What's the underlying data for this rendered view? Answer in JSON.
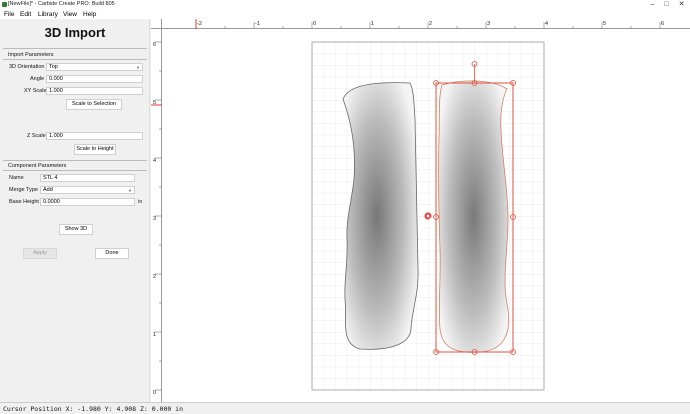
{
  "window": {
    "title": "[NewFile]* - Carbide Create PRO: Build 805",
    "minimize_glyph": "–",
    "maximize_glyph": "□",
    "close_glyph": "✕"
  },
  "menu": [
    "File",
    "Edit",
    "Library",
    "View",
    "Help"
  ],
  "panel": {
    "title": "3D Import",
    "import_section": "Import Parameters",
    "orientation_label": "3D Orientation",
    "orientation_value": "Top",
    "angle_label": "Angle",
    "angle_value": "0.000",
    "xy_scale_label": "XY Scale",
    "xy_scale_value": "1.000",
    "scale_to_selection": "Scale to Selection",
    "z_scale_label": "Z Scale",
    "z_scale_value": "1.000",
    "scale_to_height": "Scale to Height",
    "component_section": "Component Parameters",
    "name_label": "Name",
    "name_value": "STL 4",
    "merge_label": "Merge Type",
    "merge_value": "Add",
    "base_height_label": "Base Height",
    "base_height_value": "0.0000",
    "base_height_unit": "in",
    "show_3d": "Show 3D",
    "apply": "Apply",
    "done": "Done"
  },
  "rulers": {
    "top_labels": [
      "-2",
      "-1",
      "0",
      "1",
      "2",
      "3",
      "4",
      "5",
      "6"
    ],
    "left_labels": [
      "6",
      "5",
      "4",
      "3",
      "2",
      "1",
      "0"
    ]
  },
  "status": {
    "text": "Cursor Position X: -1.980 Y: 4.908 Z: 0.000 in"
  },
  "colors": {
    "selection": "#e05040",
    "grid": "#d8d8d8",
    "cursor_marker": "#e53935",
    "app_icon": "#2e7d32"
  }
}
